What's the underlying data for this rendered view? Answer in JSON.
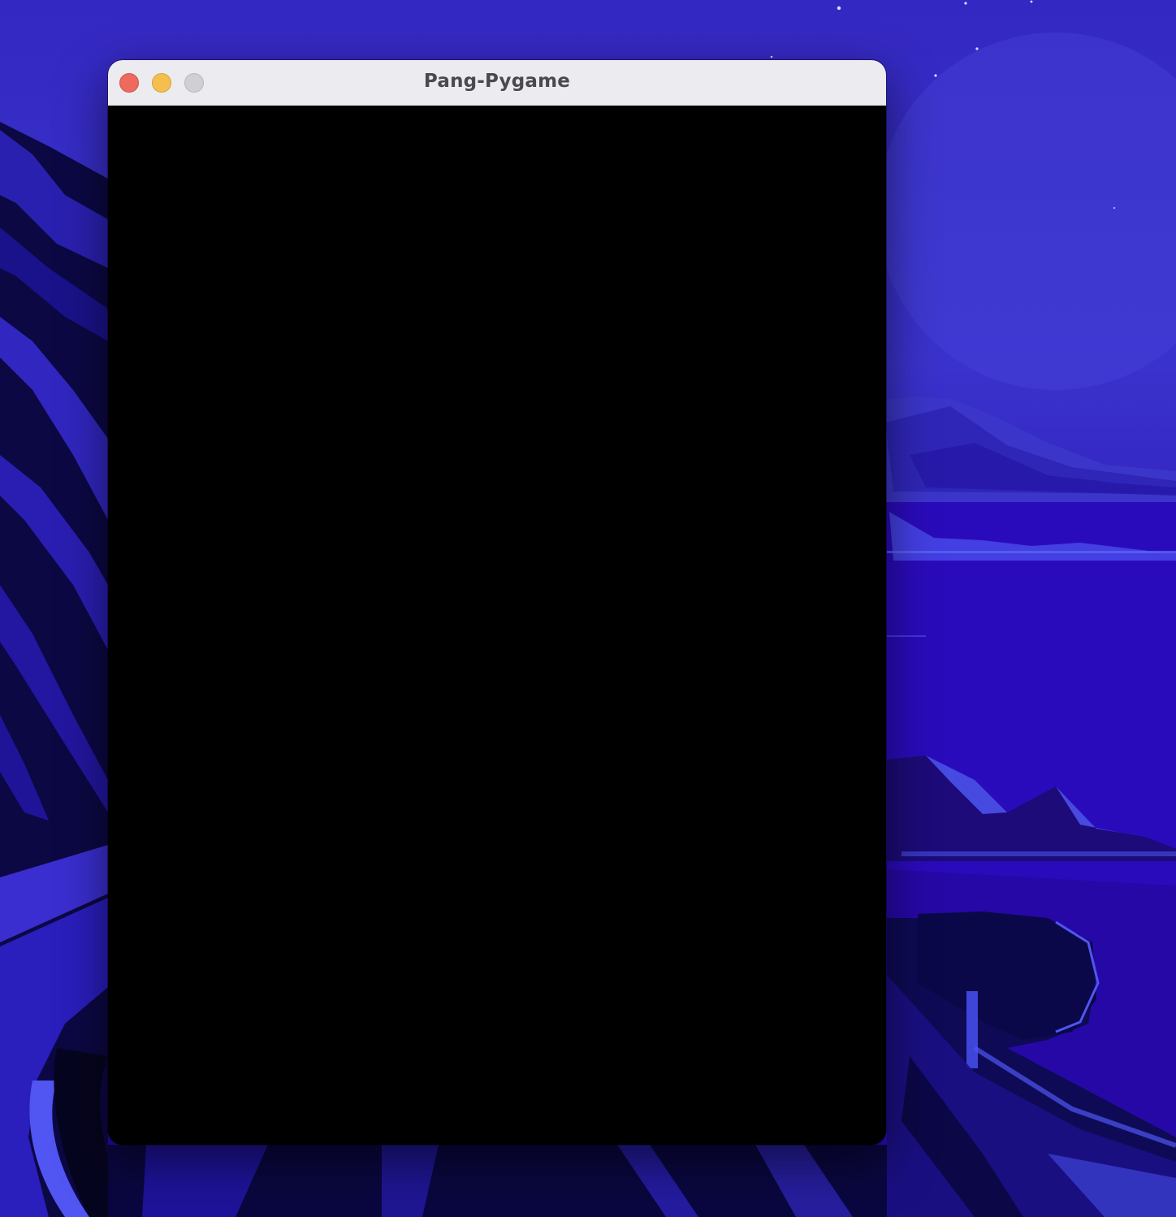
{
  "window": {
    "title": "Pang-Pygame",
    "controls": {
      "close": "close-icon",
      "minimize": "minimize-icon",
      "zoom": "zoom-icon"
    },
    "canvas_color": "#000000"
  },
  "desktop": {
    "wallpaper": "night-coastline-wallpaper",
    "colors": {
      "sky": "#3428c2",
      "sea": "#2a0eb8",
      "accent": "#4b52f0",
      "shadow": "#050522"
    }
  }
}
